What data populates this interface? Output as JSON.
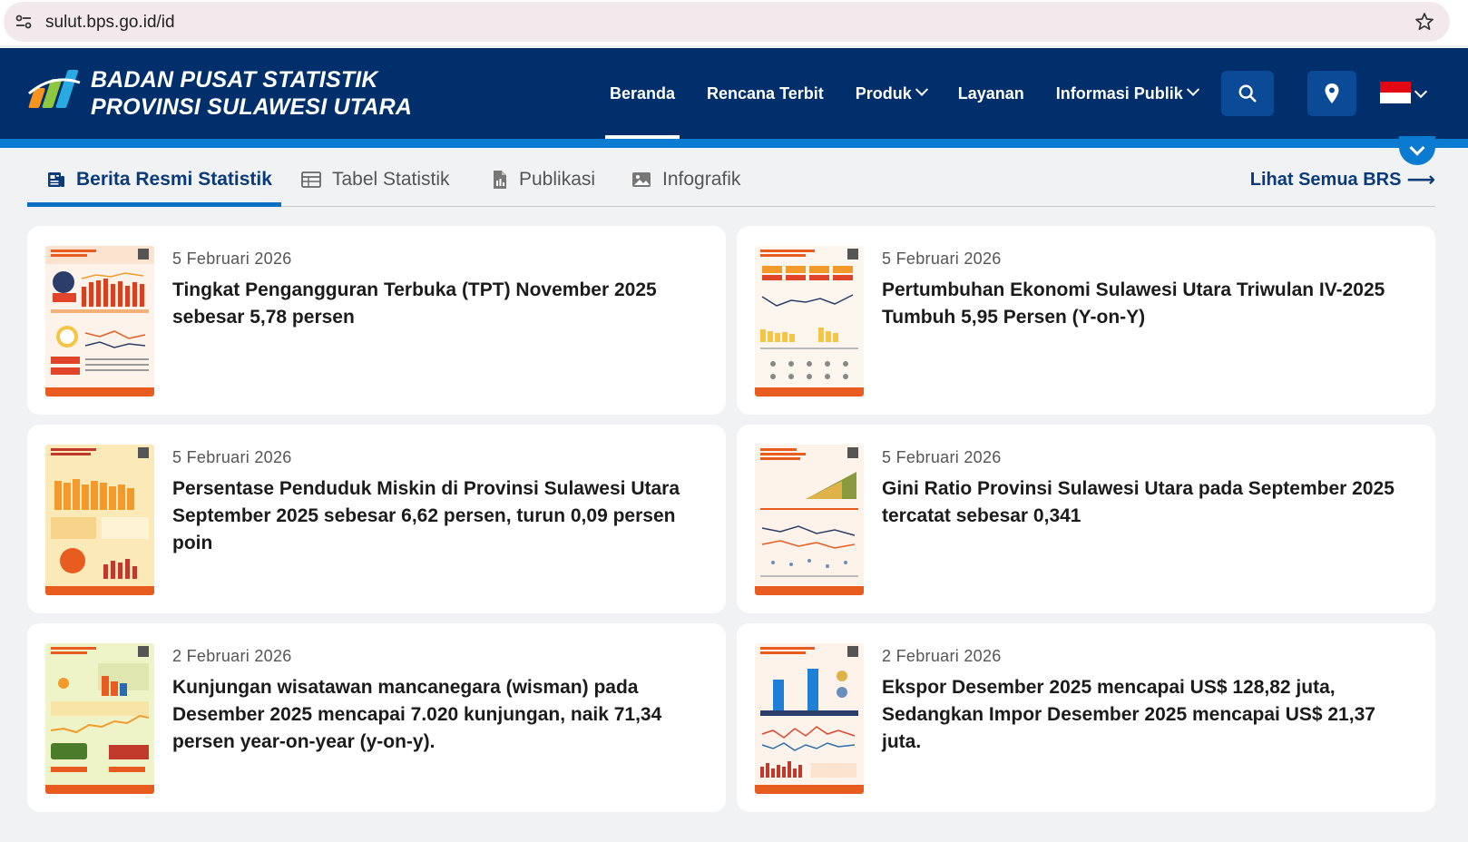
{
  "browser": {
    "url": "sulut.bps.go.id/id",
    "site_info_icon": "tune-icon",
    "bookmark_icon": "star-icon"
  },
  "header": {
    "brand_line1": "BADAN PUSAT STATISTIK",
    "brand_line2": "PROVINSI SULAWESI UTARA",
    "nav": [
      {
        "label": "Beranda",
        "active": true
      },
      {
        "label": "Rencana Terbit"
      },
      {
        "label": "Produk",
        "dropdown": true
      },
      {
        "label": "Layanan"
      },
      {
        "label": "Informasi Publik",
        "dropdown": true
      }
    ],
    "search_icon": "search-icon",
    "location_icon": "map-pin-icon",
    "language_icon": "indonesia-flag-icon",
    "colors": {
      "bg": "#002f6c",
      "strip": "#0b7bd1"
    }
  },
  "tabs": {
    "items": [
      {
        "label": "Berita Resmi Statistik",
        "icon": "news-icon",
        "active": true
      },
      {
        "label": "Tabel Statistik",
        "icon": "table-icon"
      },
      {
        "label": "Publikasi",
        "icon": "document-icon"
      },
      {
        "label": "Infografik",
        "icon": "image-icon"
      }
    ],
    "see_all": "Lihat Semua BRS",
    "see_all_icon": "arrow-right-icon"
  },
  "news": [
    {
      "date": "5 Februari 2026",
      "title": "Tingkat Pengangguran Terbuka (TPT) November 2025 sebesar 5,78 persen"
    },
    {
      "date": "5 Februari 2026",
      "title": "Pertumbuhan Ekonomi Sulawesi Utara Triwulan IV-2025 Tumbuh 5,95 Persen (Y-on-Y)"
    },
    {
      "date": "5 Februari 2026",
      "title": "Persentase Penduduk Miskin di Provinsi Sulawesi Utara September 2025 sebesar 6,62 persen, turun 0,09 persen poin"
    },
    {
      "date": "5 Februari 2026",
      "title": "Gini Ratio Provinsi Sulawesi Utara pada September 2025 tercatat sebesar 0,341"
    },
    {
      "date": "2 Februari 2026",
      "title": "Kunjungan wisatawan mancanegara (wisman) pada Desember 2025 mencapai 7.020 kunjungan, naik 71,34 persen year-on-year (y-on-y)."
    },
    {
      "date": "2 Februari 2026",
      "title": "Ekspor Desember 2025 mencapai US$ 128,82 juta, Sedangkan Impor Desember 2025 mencapai US$ 21,37 juta."
    }
  ]
}
